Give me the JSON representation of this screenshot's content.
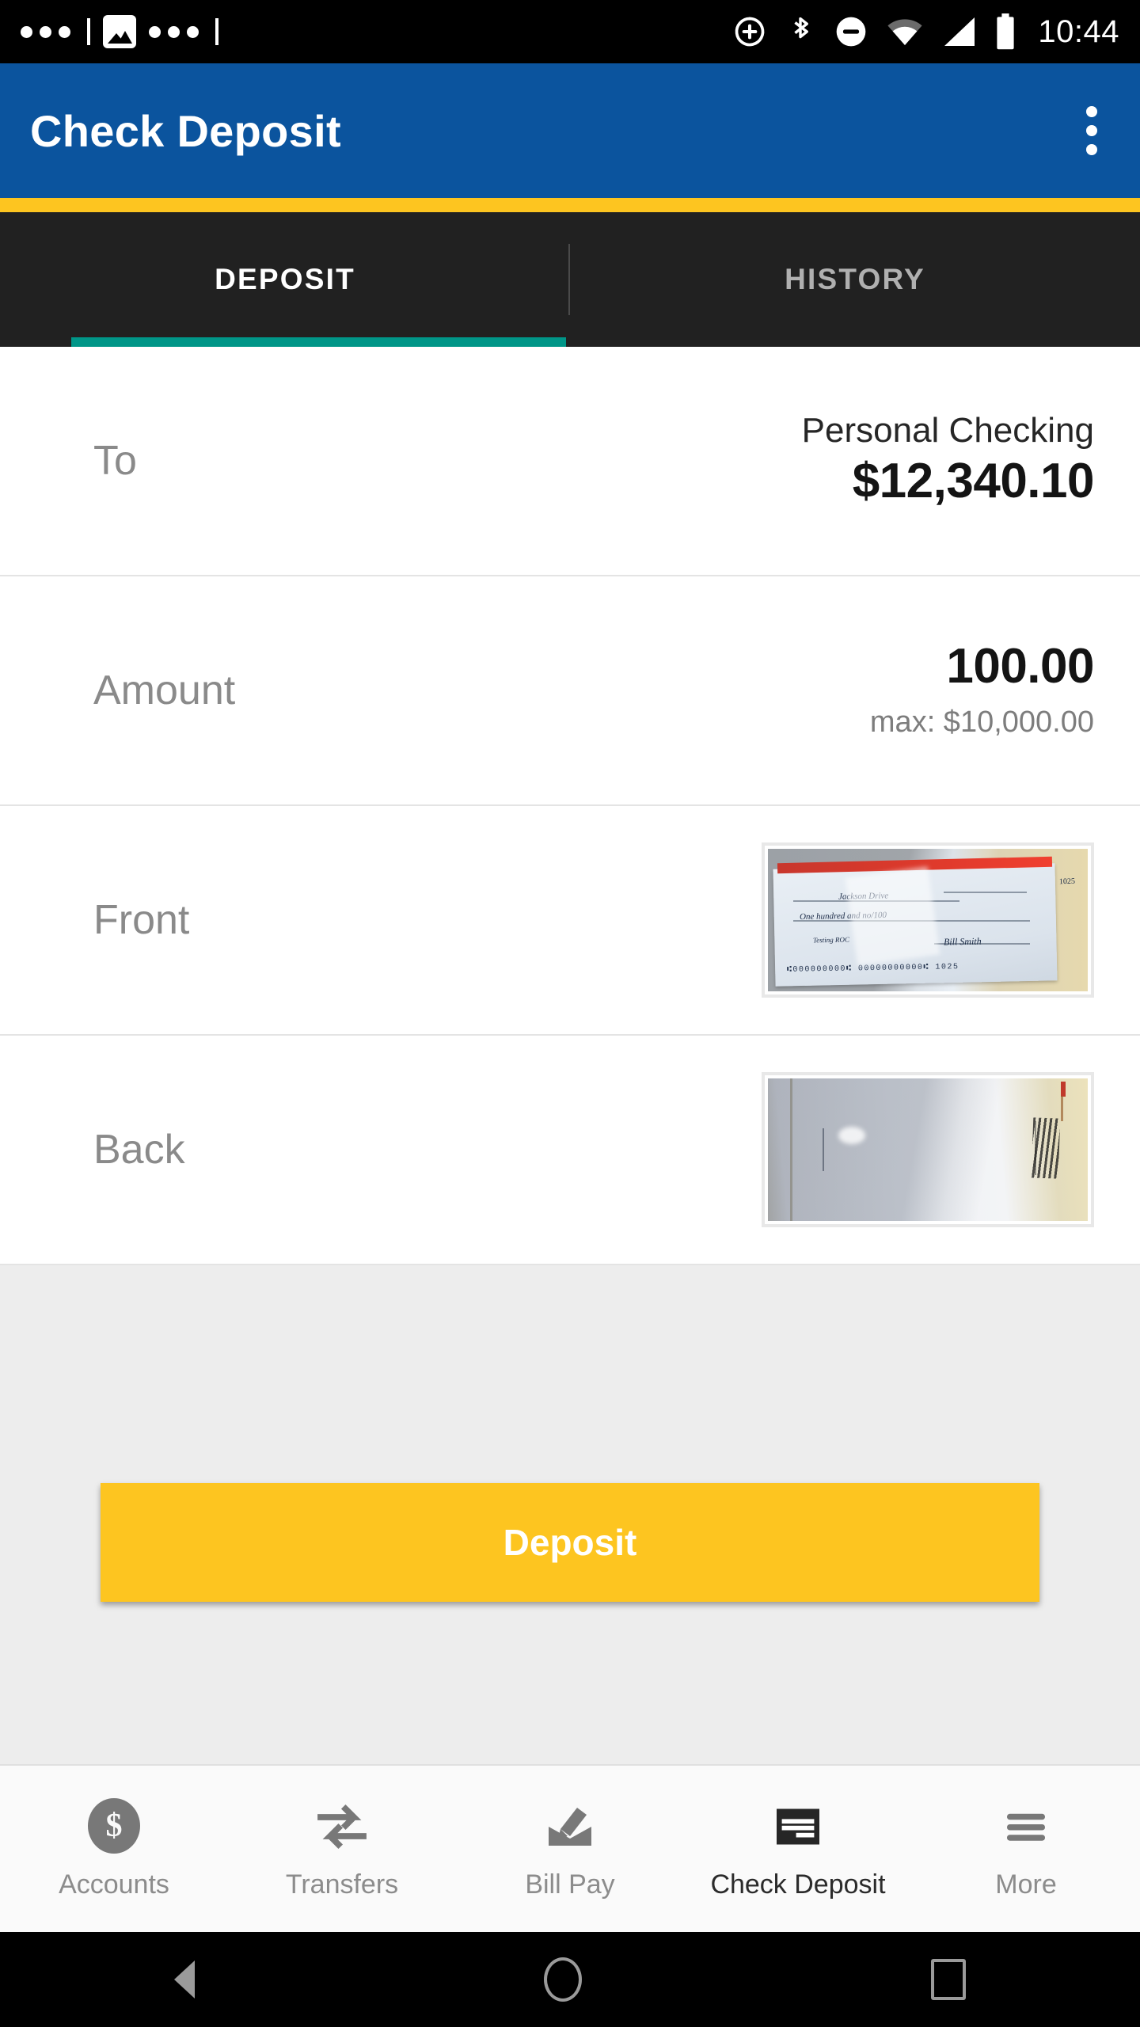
{
  "status_bar": {
    "time": "10:44",
    "left_icons": [
      "notification-dots",
      "screenshot-image-icon",
      "notification-dots"
    ],
    "right_icons": [
      "cast-icon",
      "bluetooth-icon",
      "do-not-disturb-icon",
      "wifi-icon",
      "cellular-signal-icon",
      "battery-icon"
    ]
  },
  "app_bar": {
    "title": "Check Deposit",
    "overflow_label": "More options",
    "background_color": "#0B549E",
    "accent_color": "#FDC520"
  },
  "tabs": {
    "items": [
      {
        "label": "DEPOSIT",
        "active": true
      },
      {
        "label": "HISTORY",
        "active": false
      }
    ],
    "indicator_color": "#009688",
    "background_color": "#212121"
  },
  "form": {
    "rows": [
      {
        "label": "To",
        "primary": "Personal Checking",
        "secondary": "$12,340.10",
        "type": "account"
      },
      {
        "label": "Amount",
        "primary": "100.00",
        "secondary": "max: $10,000.00",
        "type": "amount"
      },
      {
        "label": "Front",
        "type": "image",
        "image": "check-front-photo"
      },
      {
        "label": "Back",
        "type": "image",
        "image": "check-back-photo"
      }
    ]
  },
  "primary_action": {
    "label": "Deposit",
    "background_color": "#FDC520",
    "text_color": "#FFFFFF"
  },
  "bottom_nav": {
    "items": [
      {
        "label": "Accounts",
        "icon": "dollar-circle-icon",
        "active": false
      },
      {
        "label": "Transfers",
        "icon": "transfer-arrows-icon",
        "active": false
      },
      {
        "label": "Bill Pay",
        "icon": "envelope-pen-icon",
        "active": false
      },
      {
        "label": "Check Deposit",
        "icon": "check-lines-icon",
        "active": true
      },
      {
        "label": "More",
        "icon": "hamburger-menu-icon",
        "active": false
      }
    ]
  },
  "android_nav": {
    "back": "back-triangle-icon",
    "home": "home-circle-icon",
    "recents": "recents-square-icon"
  }
}
